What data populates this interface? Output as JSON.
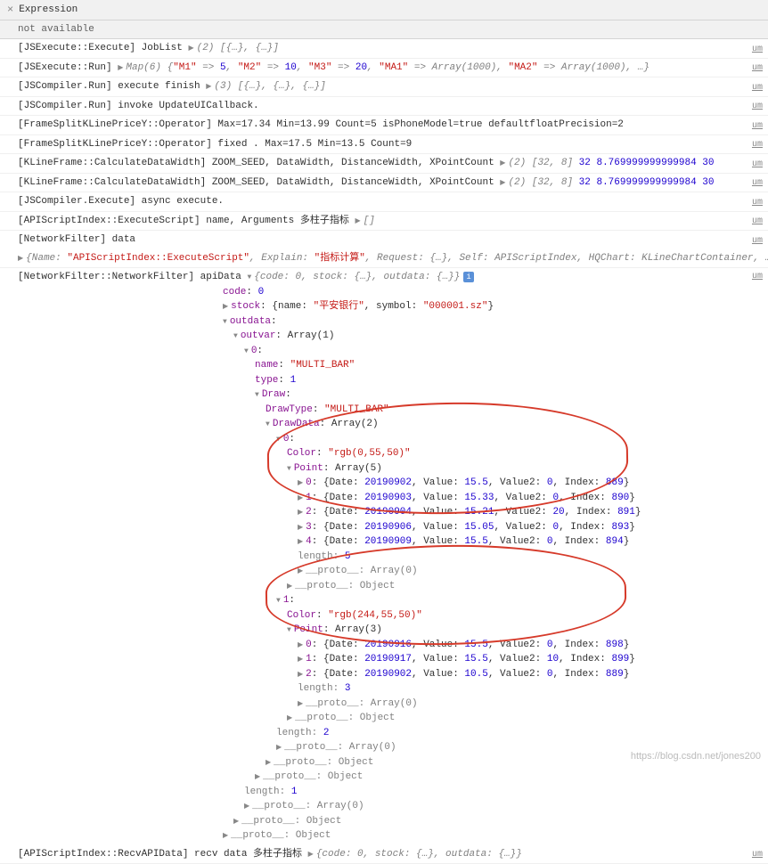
{
  "header": {
    "title": "Expression",
    "expr": "not available"
  },
  "src": "um",
  "lines": {
    "l0a": "[JSExecute::Execute] JobList ",
    "l0b": "(2) [{…}, {…}]",
    "l1a": "[JSExecute::Run] ",
    "l1b": "Map(6) {",
    "l1c": "\"M1\"",
    "l1d": " => ",
    "l1e": "5",
    "l1f": "\"M2\"",
    "l1g": "10",
    "l1h": "\"M3\"",
    "l1i": "20",
    "l1j": "\"MA1\"",
    "l1k": " => Array(1000), ",
    "l1l": "\"MA2\"",
    "l1m": " => Array(1000), …}",
    "l2a": "[JSCompiler.Run] execute finish ",
    "l2b": "(3) [{…}, {…}, {…}]",
    "l3": "[JSCompiler.Run] invoke UpdateUICallback.",
    "l4": "[FrameSplitKLinePriceY::Operator] Max=17.34 Min=13.99 Count=5 isPhoneModel=true defaultfloatPrecision=2",
    "l5": "[FrameSplitKLinePriceY::Operator] fixed . Max=17.5 Min=13.5 Count=9",
    "l6a": "[KLineFrame::CalculateDataWidth] ZOOM_SEED, DataWidth, DistanceWidth, XPointCount ",
    "l6b": "(2) [32, 8]",
    "l6c": " 32 8.769999999999984 30",
    "l7a": "[KLineFrame::CalculateDataWidth] ZOOM_SEED, DataWidth, DistanceWidth, XPointCount ",
    "l7b": "(2) [32, 8]",
    "l7c": " 32 8.769999999999984 30",
    "l8": "[JSCompiler.Execute] async execute.",
    "l9a": "[APIScriptIndex::ExecuteScript] name, Arguments  多柱子指标 ",
    "l9b": "[]",
    "l10": "[NetworkFilter] data",
    "l11a": "{Name: ",
    "l11b": "\"APIScriptIndex::ExecuteScript\"",
    "l11c": ", Explain: ",
    "l11d": "\"指标计算\"",
    "l11e": ", Request: {…}, Self: APIScriptIndex, HQChart: KLineChartContainer, …}",
    "l12a": "[NetworkFilter::NetworkFilter] apiData ",
    "l12b": "{code: 0, stock: {…}, outdata: {…}}",
    "foota": "[APIScriptIndex::RecvAPIData] recv data  多柱子指标 ",
    "footb": "{code: 0, stock: {…}, outdata: {…}}"
  },
  "tree": {
    "code": "code",
    "codeV": "0",
    "stock": "stock",
    "stockV": "{name: ",
    "stockName": "\"平安银行\"",
    "stockV2": ", symbol: ",
    "stockSym": "\"000001.sz\"",
    "stockV3": "}",
    "outdata": "outdata",
    "outvar": "outvar",
    "outvarV": "Array(1)",
    "idx0": "0",
    "name": "name",
    "nameV": "\"MULTI_BAR\"",
    "type": "type",
    "typeV": "1",
    "draw": "Draw",
    "drawType": "DrawType",
    "drawTypeV": "\"MULTI_BAR\"",
    "drawData": "DrawData",
    "drawDataV": "Array(2)",
    "dd0": "0",
    "color": "Color",
    "dd0Color": "\"rgb(0,55,50)\"",
    "point": "Point",
    "dd0PointV": "Array(5)",
    "p00a": "0",
    "p00b": "{Date: ",
    "p00date": "20190902",
    "p00c": ", Value: ",
    "p00val": "15.5",
    "p00d": ", Value2: ",
    "p00v2": "0",
    "p00e": ", Index: ",
    "p00idx": "889",
    "p00f": "}",
    "p01a": "1",
    "p01date": "20190903",
    "p01val": "15.33",
    "p01v2": "0",
    "p01idx": "890",
    "p02a": "2",
    "p02date": "20190904",
    "p02val": "15.21",
    "p02v2": "20",
    "p02idx": "891",
    "p03a": "3",
    "p03date": "20190906",
    "p03val": "15.05",
    "p03v2": "0",
    "p03idx": "893",
    "p04a": "4",
    "p04date": "20190909",
    "p04val": "15.5",
    "p04v2": "0",
    "p04idx": "894",
    "len": "length",
    "len5": "5",
    "proto": "__proto__",
    "arr0": "Array(0)",
    "obj": "Object",
    "dd1": "1",
    "dd1Color": "\"rgb(244,55,50)\"",
    "dd1PointV": "Array(3)",
    "p10a": "0",
    "p10date": "20190916",
    "p10val": "15.5",
    "p10v2": "0",
    "p10idx": "898",
    "p11a": "1",
    "p11date": "20190917",
    "p11val": "15.5",
    "p11v2": "10",
    "p11idx": "899",
    "p12a": "2",
    "p12date": "20190902",
    "p12val": "10.5",
    "p12v2": "0",
    "p12idx": "889",
    "len3": "3",
    "len2": "2",
    "len1": "1"
  },
  "watermark": "https://blog.csdn.net/jones200"
}
